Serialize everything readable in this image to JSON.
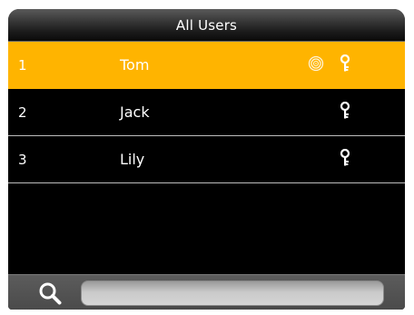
{
  "header": {
    "title": "All Users"
  },
  "users": [
    {
      "id": "1",
      "name": "Tom",
      "selected": true,
      "fingerprint": true,
      "key": true
    },
    {
      "id": "2",
      "name": "Jack",
      "selected": false,
      "fingerprint": false,
      "key": true
    },
    {
      "id": "3",
      "name": "Lily",
      "selected": false,
      "fingerprint": false,
      "key": true
    }
  ],
  "search": {
    "value": "",
    "placeholder": ""
  },
  "colors": {
    "selected_row": "#ffb400",
    "background": "#000000",
    "text": "#ffffff",
    "divider": "#bdbdbd"
  },
  "icons": {
    "fingerprint": "fingerprint-icon",
    "key": "key-icon",
    "search": "search-icon"
  }
}
